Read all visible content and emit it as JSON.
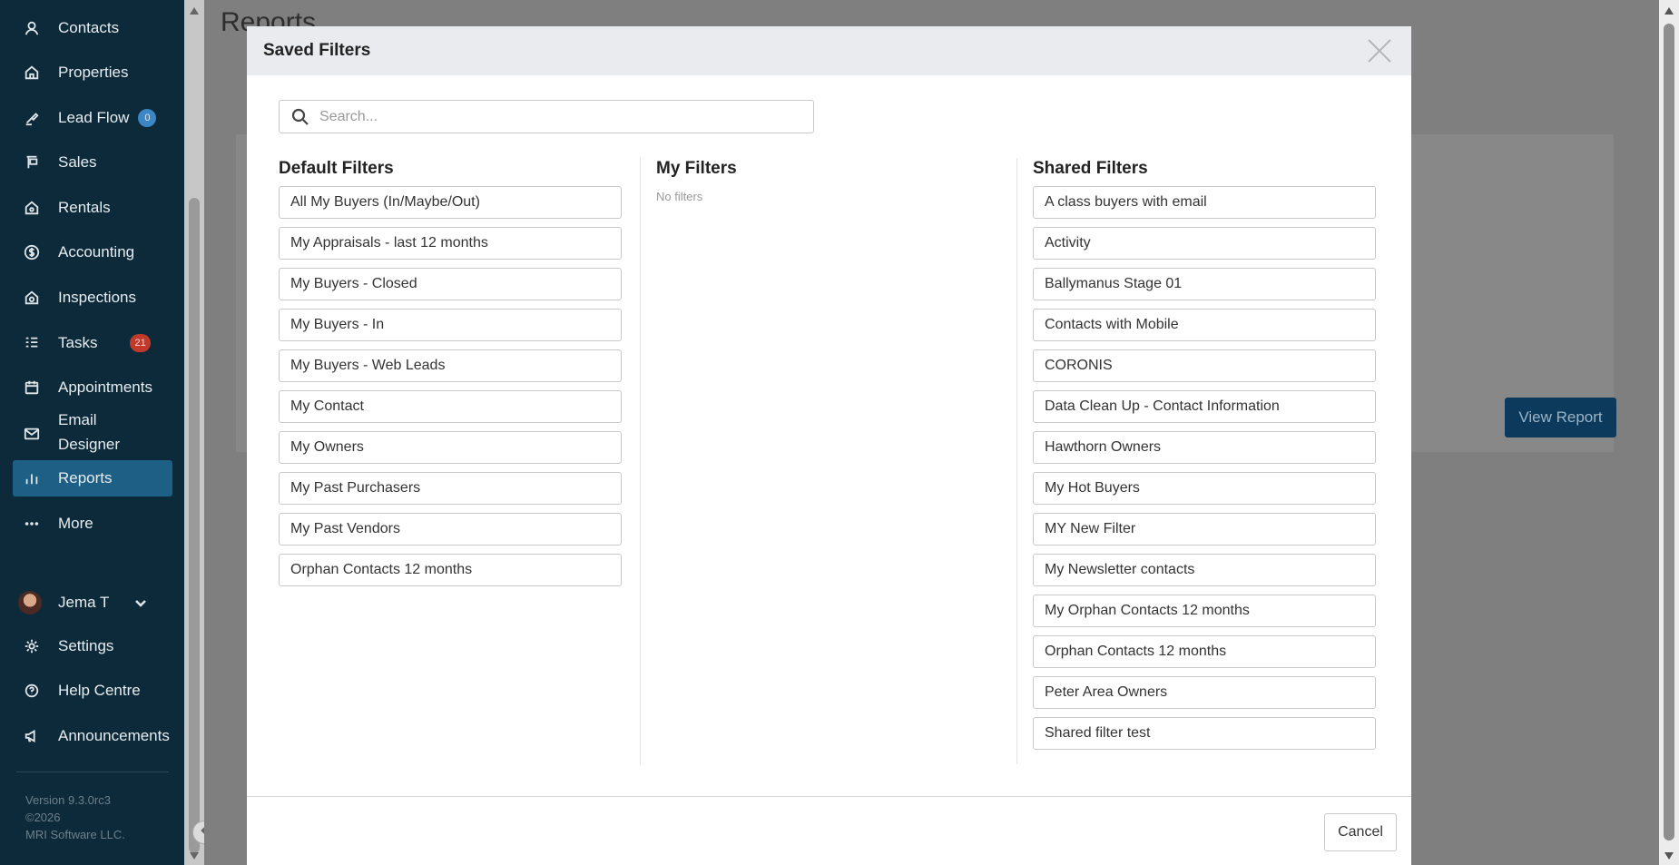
{
  "sidebar": {
    "items": [
      {
        "label": "Contacts",
        "icon": "person-icon"
      },
      {
        "label": "Properties",
        "icon": "house-icon"
      },
      {
        "label": "Lead Flow",
        "icon": "lead-flow-icon",
        "badge": "0"
      },
      {
        "label": "Sales",
        "icon": "sign-icon"
      },
      {
        "label": "Rentals",
        "icon": "home-key-icon"
      },
      {
        "label": "Accounting",
        "icon": "dollar-icon"
      },
      {
        "label": "Inspections",
        "icon": "inspection-icon"
      },
      {
        "label": "Tasks",
        "icon": "tasks-icon",
        "badge": "21"
      },
      {
        "label": "Appointments",
        "icon": "calendar-icon"
      },
      {
        "label": "Email Designer",
        "icon": "envelope-icon"
      },
      {
        "label": "Reports",
        "icon": "bar-chart-icon",
        "active": true
      },
      {
        "label": "More",
        "icon": "ellipsis-icon"
      }
    ],
    "user": {
      "name": "Jema T"
    },
    "bottom_items": [
      {
        "label": "Settings",
        "icon": "gear-icon"
      },
      {
        "label": "Help Centre",
        "icon": "help-icon"
      },
      {
        "label": "Announcements",
        "icon": "megaphone-icon"
      }
    ],
    "version_lines": [
      "Version 9.3.0rc3",
      "©2026",
      "MRI Software LLC."
    ]
  },
  "main": {
    "title": "Reports",
    "view_report": "View Report"
  },
  "modal": {
    "title": "Saved Filters",
    "search_placeholder": "Search...",
    "columns": {
      "default": {
        "title": "Default Filters",
        "items": [
          "All My Buyers (In/Maybe/Out)",
          "My Appraisals - last 12 months",
          "My Buyers - Closed",
          "My Buyers - In",
          "My Buyers - Web Leads",
          "My Contact",
          "My Owners",
          "My Past Purchasers",
          "My Past Vendors",
          "Orphan Contacts 12 months"
        ]
      },
      "mine": {
        "title": "My Filters",
        "empty_text": "No filters"
      },
      "shared": {
        "title": "Shared Filters",
        "items": [
          "A class buyers with email",
          "Activity",
          "Ballymanus Stage 01",
          "Contacts with Mobile",
          "CORONIS",
          "Data Clean Up - Contact Information",
          "Hawthorn Owners",
          "My Hot Buyers",
          "MY New Filter",
          "My Newsletter contacts",
          "My Orphan Contacts 12 months",
          "Orphan Contacts 12 months",
          "Peter Area Owners",
          "Shared filter test"
        ]
      }
    },
    "cancel_label": "Cancel"
  },
  "colors": {
    "sidebar_bg": "#0d2a3a",
    "active_item": "#1e5f86",
    "primary_button": "#0b3a5c"
  }
}
